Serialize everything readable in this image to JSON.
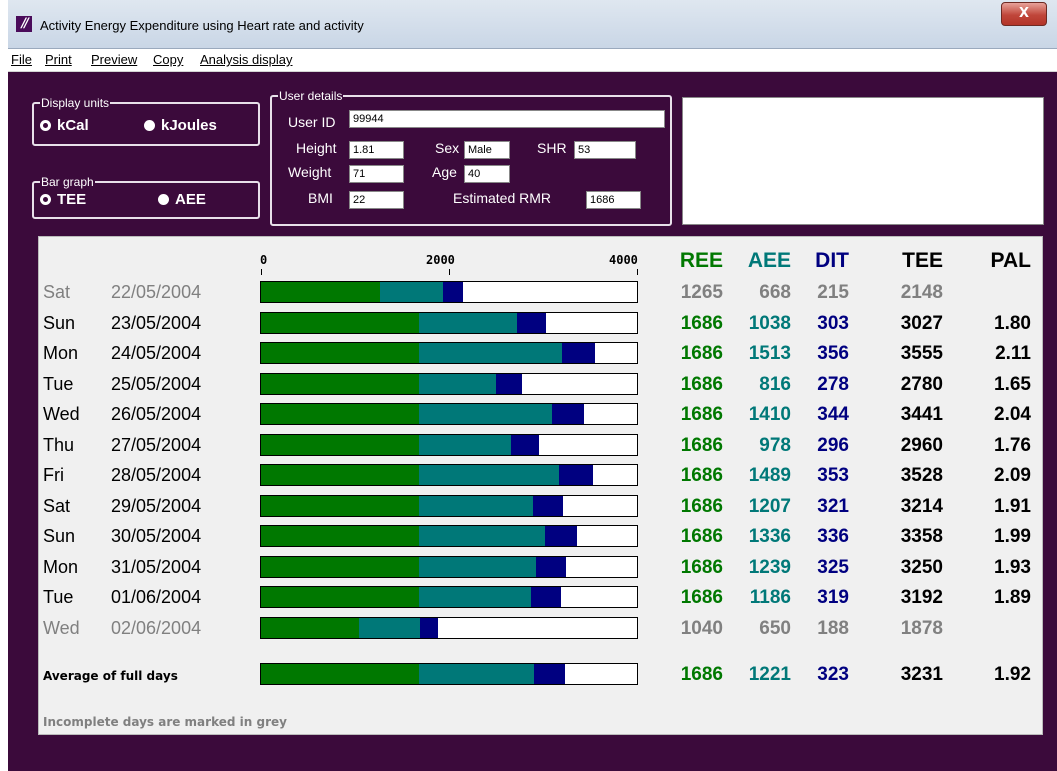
{
  "window": {
    "title": "Activity Energy Expenditure using Heart rate and activity",
    "close_glyph": "X",
    "app_icon_glyph": "//"
  },
  "menu": [
    "File",
    "Print",
    "Preview",
    "Copy",
    "Analysis display"
  ],
  "display_units": {
    "legend": "Display units",
    "options": [
      {
        "label": "kCal",
        "selected": true
      },
      {
        "label": "kJoules",
        "selected": false
      }
    ]
  },
  "bar_graph": {
    "legend": "Bar graph",
    "options": [
      {
        "label": "TEE",
        "selected": true
      },
      {
        "label": "AEE",
        "selected": false
      }
    ]
  },
  "user_details": {
    "legend": "User details",
    "user_id_label": "User ID",
    "user_id": "99944",
    "height_label": "Height",
    "height": "1.81",
    "sex_label": "Sex",
    "sex": "Male",
    "shr_label": "SHR",
    "shr": "53",
    "weight_label": "Weight",
    "weight": "71",
    "age_label": "Age",
    "age": "40",
    "bmi_label": "BMI",
    "bmi": "22",
    "rmr_label": "Estimated RMR",
    "rmr": "1686"
  },
  "columns": [
    "REE",
    "AEE",
    "DIT",
    "TEE",
    "PAL"
  ],
  "colors": {
    "ree": "#007800",
    "aee": "#007878",
    "dit": "#000080",
    "incomplete": "#808080",
    "background": "#3b0a3b"
  },
  "chart_data": {
    "type": "bar",
    "stacked": true,
    "orientation": "horizontal",
    "x_ticks": [
      "0",
      "2000",
      "4000"
    ],
    "xlim": [
      0,
      4000
    ],
    "rows": [
      {
        "day": "Sat",
        "date": "22/05/2004",
        "ree": 1265,
        "aee": 668,
        "dit": 215,
        "tee": 2148,
        "pal": "",
        "complete": false
      },
      {
        "day": "Sun",
        "date": "23/05/2004",
        "ree": 1686,
        "aee": 1038,
        "dit": 303,
        "tee": 3027,
        "pal": "1.80",
        "complete": true
      },
      {
        "day": "Mon",
        "date": "24/05/2004",
        "ree": 1686,
        "aee": 1513,
        "dit": 356,
        "tee": 3555,
        "pal": "2.11",
        "complete": true
      },
      {
        "day": "Tue",
        "date": "25/05/2004",
        "ree": 1686,
        "aee": 816,
        "dit": 278,
        "tee": 2780,
        "pal": "1.65",
        "complete": true
      },
      {
        "day": "Wed",
        "date": "26/05/2004",
        "ree": 1686,
        "aee": 1410,
        "dit": 344,
        "tee": 3441,
        "pal": "2.04",
        "complete": true
      },
      {
        "day": "Thu",
        "date": "27/05/2004",
        "ree": 1686,
        "aee": 978,
        "dit": 296,
        "tee": 2960,
        "pal": "1.76",
        "complete": true
      },
      {
        "day": "Fri",
        "date": "28/05/2004",
        "ree": 1686,
        "aee": 1489,
        "dit": 353,
        "tee": 3528,
        "pal": "2.09",
        "complete": true
      },
      {
        "day": "Sat",
        "date": "29/05/2004",
        "ree": 1686,
        "aee": 1207,
        "dit": 321,
        "tee": 3214,
        "pal": "1.91",
        "complete": true
      },
      {
        "day": "Sun",
        "date": "30/05/2004",
        "ree": 1686,
        "aee": 1336,
        "dit": 336,
        "tee": 3358,
        "pal": "1.99",
        "complete": true
      },
      {
        "day": "Mon",
        "date": "31/05/2004",
        "ree": 1686,
        "aee": 1239,
        "dit": 325,
        "tee": 3250,
        "pal": "1.93",
        "complete": true
      },
      {
        "day": "Tue",
        "date": "01/06/2004",
        "ree": 1686,
        "aee": 1186,
        "dit": 319,
        "tee": 3192,
        "pal": "1.89",
        "complete": true
      },
      {
        "day": "Wed",
        "date": "02/06/2004",
        "ree": 1040,
        "aee": 650,
        "dit": 188,
        "tee": 1878,
        "pal": "",
        "complete": false
      }
    ],
    "average": {
      "label": "Average of full days",
      "ree": 1686,
      "aee": 1221,
      "dit": 323,
      "tee": 3231,
      "pal": "1.92"
    }
  },
  "footer_note": "Incomplete days are marked in grey"
}
